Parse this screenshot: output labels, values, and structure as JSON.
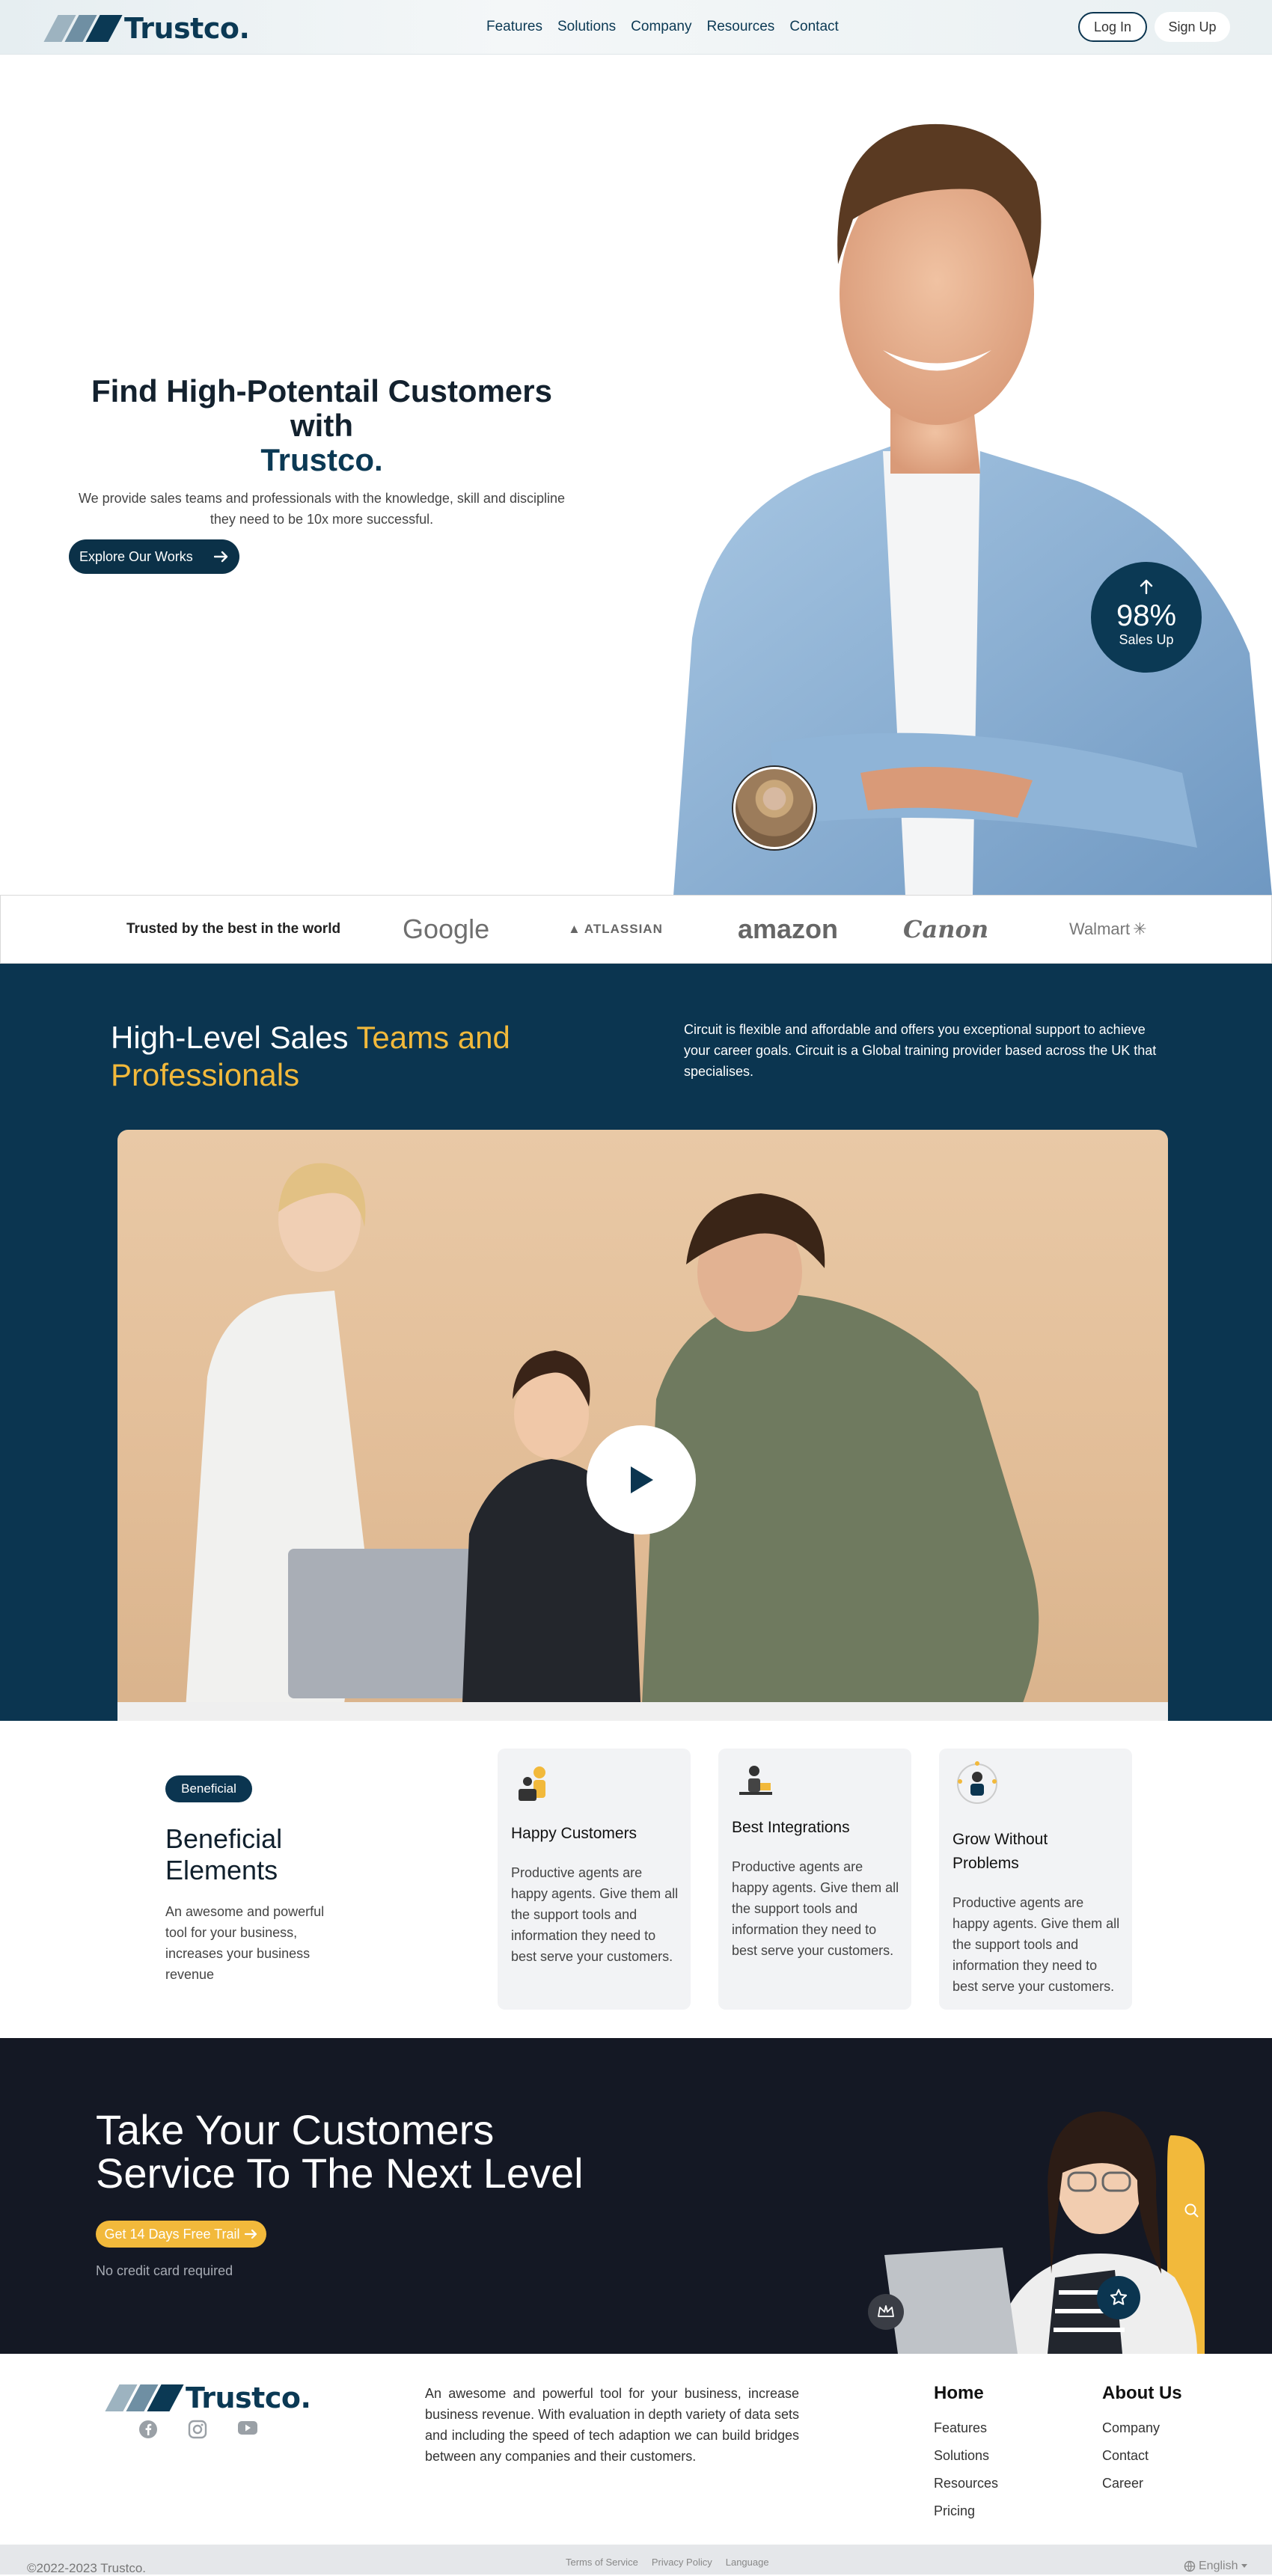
{
  "nav": {
    "brand": "Trustco.",
    "links": [
      "Features",
      "Solutions",
      "Company",
      "Resources",
      "Contact"
    ],
    "login": "Log In",
    "signup": "Sign Up"
  },
  "hero": {
    "title_line1": "Find High-Potentail Customers",
    "title_line2": "with",
    "title_brand": "Trustco.",
    "subtitle": "We provide sales teams and professionals with the knowledge, skill and discipline they need to be 10x more successful.",
    "cta": "Explore Our Works",
    "stat_value": "98%",
    "stat_label": "Sales Up"
  },
  "trusted": {
    "label": "Trusted by the best in the world",
    "logos": [
      "Google",
      "ATLASSIAN",
      "amazon",
      "Canon",
      "Walmart"
    ]
  },
  "sales": {
    "title_white": "High-Level Sales ",
    "title_yellow": "Teams and Professionals",
    "description": "Circuit is flexible and affordable and offers you exceptional support to achieve your career goals. Circuit is a Global training provider based across the UK that specialises."
  },
  "benefits": {
    "tag": "Beneficial",
    "title": "Beneficial Elements",
    "description": "An awesome and powerful tool for your business, increases your business revenue",
    "cards": [
      {
        "title": "Happy Customers",
        "text": "Productive agents are happy agents. Give them all the support tools and information they need to best serve your customers."
      },
      {
        "title": "Best Integrations",
        "text": "Productive agents are happy agents. Give them all the support tools and information they need to best serve your customers."
      },
      {
        "title": "Grow Without Problems",
        "text": "Productive agents are happy agents. Give them all the support tools and information they need to best serve your customers."
      }
    ]
  },
  "cta": {
    "title_line1": "Take Your Customers",
    "title_line2": "Service To The Next Level",
    "button": "Get 14 Days Free Trail",
    "note": "No credit card required"
  },
  "footer": {
    "brand": "Trustco.",
    "description": "An awesome and powerful tool for your business, increase business revenue. With evaluation in depth variety of data sets and including the speed of tech adaption we can build bridges between any companies and their customers.",
    "col1_title": "Home",
    "col1_links": [
      "Features",
      "Solutions",
      "Resources",
      "Pricing"
    ],
    "col2_title": "About Us",
    "col2_links": [
      "Company",
      "Contact",
      "Career"
    ],
    "copyright": "©2022-2023 Trustco.",
    "bottom_links": [
      "Terms of Service",
      "Privacy Policy",
      "Language"
    ],
    "language": "English"
  },
  "colors": {
    "navy": "#0b3550",
    "accent": "#f2b93b",
    "dark": "#141824"
  }
}
